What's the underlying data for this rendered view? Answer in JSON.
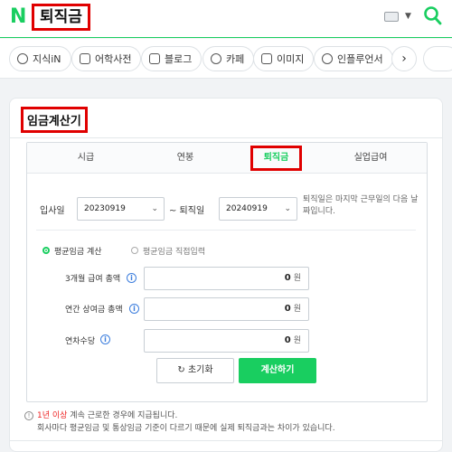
{
  "header": {
    "logo": "N",
    "query": "퇴직금"
  },
  "chips": [
    {
      "label": "지식iN",
      "icon": "search-icon"
    },
    {
      "label": "어학사전",
      "icon": "book-icon"
    },
    {
      "label": "블로그",
      "icon": "chat-icon"
    },
    {
      "label": "카페",
      "icon": "cup-icon"
    },
    {
      "label": "이미지",
      "icon": "image-icon"
    },
    {
      "label": "인플루언서",
      "icon": "person-icon"
    }
  ],
  "next_icon": "›",
  "panel": {
    "title": "임금계산기"
  },
  "tabs": [
    "시급",
    "연봉",
    "퇴직금",
    "실업급여"
  ],
  "active_tab": "퇴직금",
  "dates": {
    "join_label": "입사일",
    "join_value": "20230919",
    "separator": "~ 퇴직일",
    "leave_value": "20240919",
    "note": "퇴직일은 마지막 근무일의 다음 날짜입니다."
  },
  "mode": {
    "option1": "평균임금 계산",
    "option2": "평균임금 직접입력",
    "selected": "평균임금 계산"
  },
  "fields": [
    {
      "label": "3개월 급여 총액",
      "value": "0",
      "unit": "원"
    },
    {
      "label": "연간 상여금 총액",
      "value": "0",
      "unit": "원"
    },
    {
      "label": "연차수당",
      "value": "0",
      "unit": "원"
    }
  ],
  "buttons": {
    "reset": "초기화",
    "reset_icon": "↻",
    "calc": "계산하기"
  },
  "footnote": {
    "highlight": "1년 이상",
    "line1_rest": " 계속 근로한 경우에 지급됩니다.",
    "line2": "회사마다 평균임금 및 통상임금 기준이 다르기 때문에 실제 퇴직금과는 차이가 있습니다."
  },
  "colors": {
    "brand": "#19ce60",
    "highlight_box": "#e00000",
    "info": "#3b7ddd"
  }
}
